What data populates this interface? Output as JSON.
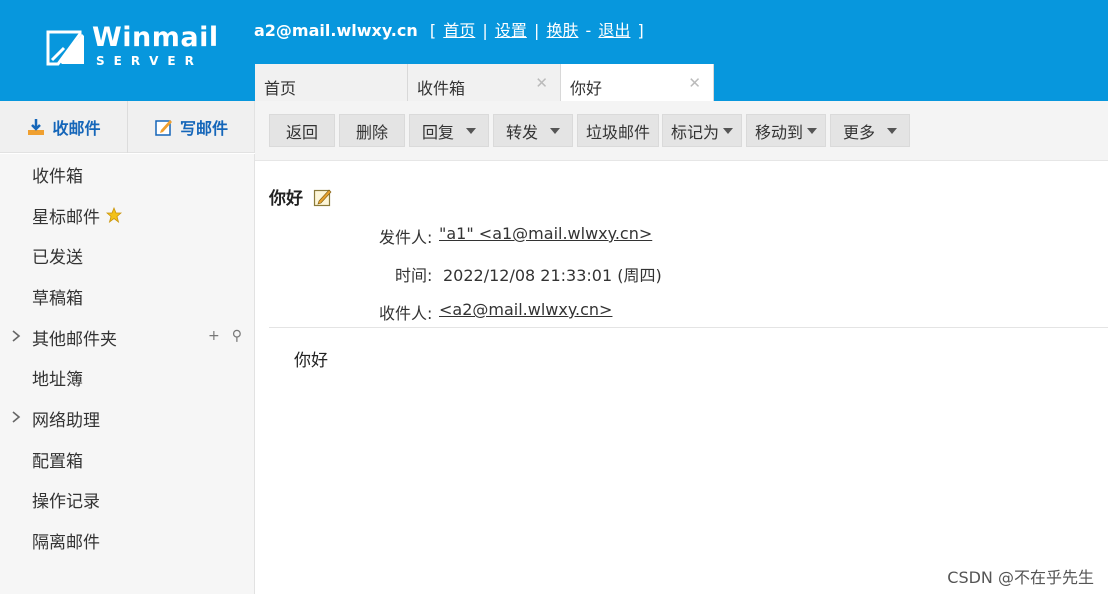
{
  "header": {
    "logo_word": "Winmail",
    "logo_sub": "SERVER",
    "user_email": "a2@mail.wlwxy.cn",
    "links": [
      "首页",
      "设置",
      "换肤",
      "退出"
    ],
    "bg_color": "#0797dd"
  },
  "tabs": [
    {
      "label": "首页",
      "closable": false
    },
    {
      "label": "收件箱",
      "closable": true
    },
    {
      "label": "你好",
      "closable": true,
      "active": true
    }
  ],
  "leftbar": {
    "receive": "收邮件",
    "compose": "写邮件"
  },
  "sidebar": {
    "items": [
      {
        "label": "收件箱"
      },
      {
        "label": "星标邮件",
        "icon": "star-icon"
      },
      {
        "label": "已发送"
      },
      {
        "label": "草稿箱"
      },
      {
        "label": "其他邮件夹",
        "expandable": true,
        "tools": [
          "+",
          "⚲"
        ]
      },
      {
        "label": "地址簿"
      },
      {
        "label": "网络助理",
        "expandable": true
      },
      {
        "label": "配置箱"
      },
      {
        "label": "操作记录"
      },
      {
        "label": "隔离邮件"
      }
    ]
  },
  "toolbar": {
    "back": "返回",
    "delete": "删除",
    "reply": "回复",
    "forward": "转发",
    "spam": "垃圾邮件",
    "mark_as": "标记为",
    "move_to": "移动到",
    "more": "更多"
  },
  "message": {
    "subject": "你好",
    "from_label": "发件人:",
    "from_value": "\"a1\" <a1@mail.wlwxy.cn>",
    "time_label": "时间:",
    "time_value": "2022/12/08 21:33:01 (周四)",
    "to_label": "收件人:",
    "to_value": "<a2@mail.wlwxy.cn>",
    "body": "你好"
  },
  "watermark": "CSDN @不在乎先生"
}
